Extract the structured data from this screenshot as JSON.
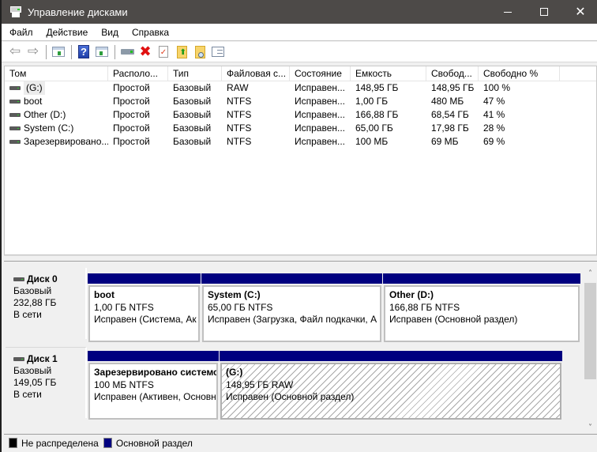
{
  "window": {
    "title": "Управление дисками",
    "minimize_label": "—",
    "maximize_label": "□",
    "close_label": "✕"
  },
  "menubar": {
    "items": [
      "Файл",
      "Действие",
      "Вид",
      "Справка"
    ]
  },
  "toolbar": {
    "buttons": [
      {
        "icon": "back-arrow-icon",
        "enabled": false
      },
      {
        "icon": "forward-arrow-icon",
        "enabled": false
      },
      {
        "icon": "show-hide-console-tree-icon"
      },
      {
        "icon": "help-icon"
      },
      {
        "icon": "show-hide-action-pane-icon"
      },
      {
        "icon": "connect-virtual-disk-icon"
      },
      {
        "icon": "delete-icon"
      },
      {
        "icon": "properties-icon"
      },
      {
        "icon": "folder-up-icon"
      },
      {
        "icon": "folder-search-icon"
      },
      {
        "icon": "settings-list-icon"
      }
    ],
    "help_glyph": "?",
    "delete_glyph": "✖",
    "check_glyph": "✓",
    "up_glyph": "⬆",
    "back_glyph": "⇦",
    "forward_glyph": "⇨"
  },
  "volume_list": {
    "columns": [
      "Том",
      "Располо...",
      "Тип",
      "Файловая с...",
      "Состояние",
      "Емкость",
      "Свобод...",
      "Свободно %",
      ""
    ],
    "rows": [
      {
        "name": " (G:)",
        "layout": "Простой",
        "type": "Базовый",
        "fs": "RAW",
        "status": "Исправен...",
        "capacity": "148,95 ГБ",
        "free": "148,95 ГБ",
        "free_pct": "100 %"
      },
      {
        "name": "boot",
        "layout": "Простой",
        "type": "Базовый",
        "fs": "NTFS",
        "status": "Исправен...",
        "capacity": "1,00 ГБ",
        "free": "480 МБ",
        "free_pct": "47 %"
      },
      {
        "name": "Other (D:)",
        "layout": "Простой",
        "type": "Базовый",
        "fs": "NTFS",
        "status": "Исправен...",
        "capacity": "166,88 ГБ",
        "free": "68,54 ГБ",
        "free_pct": "41 %"
      },
      {
        "name": "System (C:)",
        "layout": "Простой",
        "type": "Базовый",
        "fs": "NTFS",
        "status": "Исправен...",
        "capacity": "65,00 ГБ",
        "free": "17,98 ГБ",
        "free_pct": "28 %"
      },
      {
        "name": "Зарезервировано...",
        "layout": "Простой",
        "type": "Базовый",
        "fs": "NTFS",
        "status": "Исправен...",
        "capacity": "100 МБ",
        "free": "69 МБ",
        "free_pct": "69 %"
      }
    ]
  },
  "disks": [
    {
      "title": "Диск 0",
      "type": "Базовый",
      "size": "232,88 ГБ",
      "state": "В сети",
      "partitions": [
        {
          "name": "boot",
          "size_fs": "1,00 ГБ NTFS",
          "status": "Исправен (Система, Ак",
          "hatched": false
        },
        {
          "name": "System  (C:)",
          "size_fs": "65,00 ГБ NTFS",
          "status": "Исправен (Загрузка, Файл подкачки, А",
          "hatched": false
        },
        {
          "name": "Other  (D:)",
          "size_fs": "166,88 ГБ NTFS",
          "status": "Исправен (Основной раздел)",
          "hatched": false
        }
      ]
    },
    {
      "title": "Диск 1",
      "type": "Базовый",
      "size": "149,05 ГБ",
      "state": "В сети",
      "partitions": [
        {
          "name": "Зарезервировано системс",
          "size_fs": "100 МБ NTFS",
          "status": "Исправен (Активен, Основн",
          "hatched": false
        },
        {
          "name": " (G:)",
          "size_fs": "148,95 ГБ RAW",
          "status": "Исправен (Основной раздел)",
          "hatched": true
        }
      ]
    }
  ],
  "scrollbar": {
    "up_glyph": "˄",
    "down_glyph": "˅"
  },
  "legend": [
    {
      "label": "Не распределена",
      "color": "#000000"
    },
    {
      "label": "Основной раздел",
      "color": "#000080"
    }
  ],
  "colors": {
    "titlebar": "#4d4a48",
    "primary_partition": "#000080",
    "unallocated": "#000000"
  }
}
